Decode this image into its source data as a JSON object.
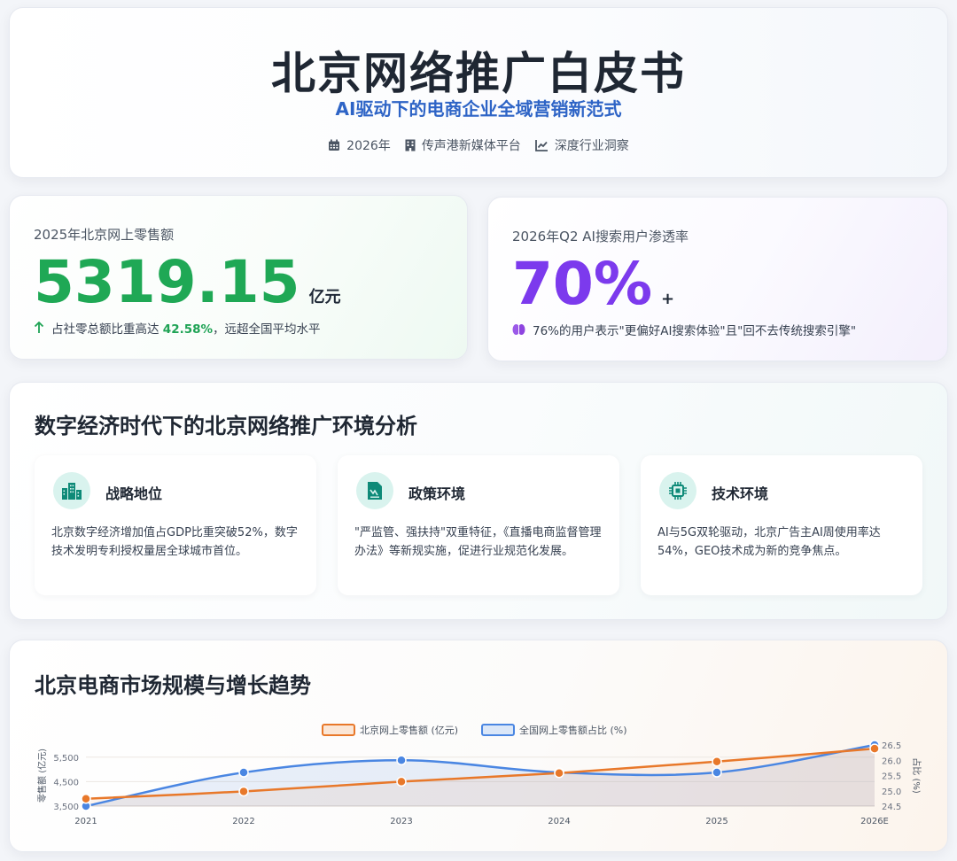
{
  "hero": {
    "title": "北京网络推广白皮书",
    "subtitle": "AI驱动下的电商企业全域营销新范式",
    "meta": [
      {
        "icon": "calendar-icon",
        "text": "2026年"
      },
      {
        "icon": "building-icon",
        "text": "传声港新媒体平台"
      },
      {
        "icon": "line-chart-icon",
        "text": "深度行业洞察"
      }
    ]
  },
  "stats": {
    "left": {
      "label": "2025年北京网上零售额",
      "value": "5319.15",
      "unit": "亿元",
      "note_prefix": "占社零总额比重高达",
      "note_highlight": "42.58%",
      "note_suffix": "，远超全国平均水平",
      "accent": "#1fa855"
    },
    "right": {
      "label": "2026年Q2 AI搜索用户渗透率",
      "value": "70%",
      "unit": "+",
      "note": "76%的用户表示\"更偏好AI搜索体验\"且\"回不去传统搜索引擎\"",
      "accent": "#7c3aed"
    }
  },
  "analysis": {
    "title": "数字经济时代下的北京网络推广环境分析",
    "cards": [
      {
        "icon": "city-buildings-icon",
        "title": "战略地位",
        "desc": "北京数字经济增加值占GDP比重突破52%，数字技术发明专利授权量居全球城市首位。"
      },
      {
        "icon": "policy-document-icon",
        "title": "政策环境",
        "desc": "\"严监管、强扶持\"双重特征，《直播电商监督管理办法》等新规实施，促进行业规范化发展。"
      },
      {
        "icon": "chip-icon",
        "title": "技术环境",
        "desc": "AI与5G双轮驱动，北京广告主AI周使用率达54%，GEO技术成为新的竞争焦点。"
      }
    ],
    "icon_color": "#0e8a78"
  },
  "trend": {
    "title": "北京电商市场规模与增长趋势"
  },
  "chart_data": {
    "type": "line",
    "x": [
      "2021",
      "2022",
      "2023",
      "2024",
      "2025",
      "2026E"
    ],
    "series": [
      {
        "name": "北京网上零售额 (亿元)",
        "axis": "left",
        "color": "#e8782a",
        "values": [
          3800,
          4100,
          4500,
          4850,
          5319.15,
          5850
        ]
      },
      {
        "name": "全国网上零售额占比 (%)",
        "axis": "right",
        "color": "#4a86e2",
        "values": [
          24.5,
          25.6,
          26.0,
          25.6,
          25.6,
          26.5
        ]
      }
    ],
    "ylabel": "零售额 (亿元)",
    "y2label": "占比 (%)",
    "y_ticks": [
      "3,500",
      "4,500",
      "5,500"
    ],
    "y2_ticks": [
      "24.5",
      "25.0",
      "25.5",
      "26.0",
      "26.5"
    ],
    "ylim": [
      3500,
      6000
    ],
    "y2lim": [
      24.5,
      26.5
    ],
    "legend": "top-center",
    "grid": true
  }
}
